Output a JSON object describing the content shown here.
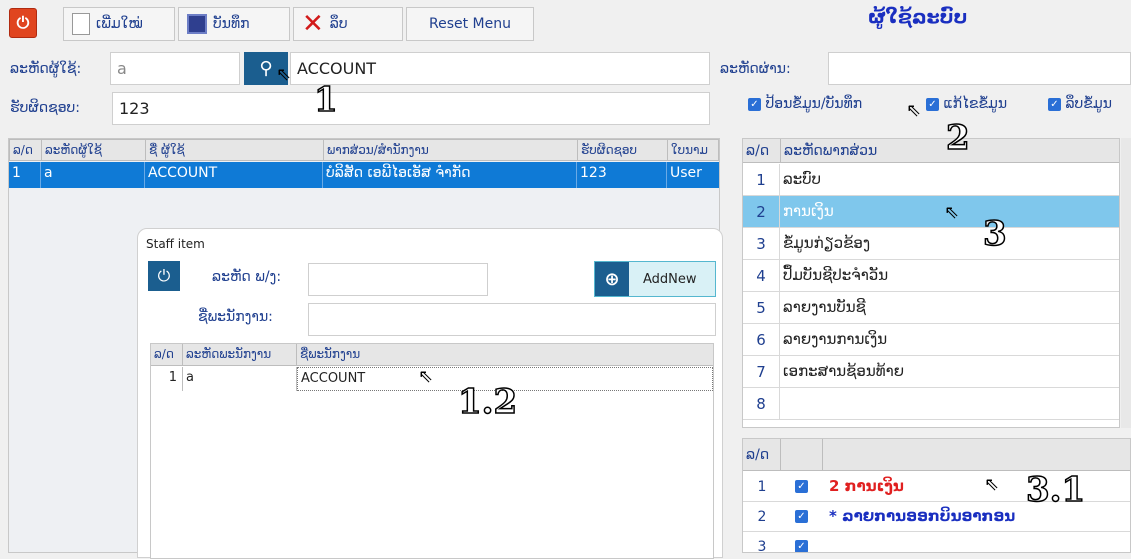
{
  "toolbar": {
    "new_label": "ເພີ່ມໃໝ່",
    "save_label": "ບັນທຶກ",
    "delete_label": "ລຶບ",
    "reset_label": "Reset Menu"
  },
  "header": {
    "title": "ຜູ້ໃຊ້ລະບົບ"
  },
  "form": {
    "user_code_label": "ລະຫັດຜູ້ໃຊ້:",
    "user_code_value": "a",
    "user_name_value": "ACCOUNT",
    "password_label": "ລະຫັດຜ່ານ:",
    "responsible_label": "ຮັບຜິດຊອບ:",
    "responsible_value": "123"
  },
  "permissions": {
    "input_save": "ປ້ອນຂໍ້ມູນ/ບັນທຶກ",
    "edit": "ແກ້ໄຂຂໍ້ມູນ",
    "delete": "ລຶບຂໍ້ມູນ"
  },
  "users_table": {
    "columns": [
      "ລ/ດ",
      "ລະຫັດຜູ້ໃຊ້",
      "ຊື່ ຜູ້ໃຊ້",
      "ພາກສ່ວນ/ສຳນັກງານ",
      "ຮັບຜິດຊອບ",
      "ໃບນາມ"
    ],
    "rows": [
      [
        "1",
        "a",
        "ACCOUNT",
        "ບໍລິສັດ ເອພີໄອເອັສ ຈຳກັດ",
        "123",
        "User"
      ]
    ]
  },
  "staff_panel": {
    "title": "Staff item",
    "staff_code_label": "ລະຫັດ ພ/ງ:",
    "staff_name_label": "ຊື່ພະນັກງານ:",
    "add_new_label": "AddNew",
    "columns": [
      "ລ/ດ",
      "ລະຫັດພະນັກງານ",
      "ຊື່ພະນັກງານ"
    ],
    "rows": [
      [
        "1",
        "a",
        "ACCOUNT"
      ]
    ]
  },
  "sections_table": {
    "columns": [
      "ລ/ດ",
      "ລະຫັດພາກສ່ວນ"
    ],
    "rows": [
      [
        "1",
        "ລະບົບ"
      ],
      [
        "2",
        "ການເງິນ"
      ],
      [
        "3",
        "ຂໍ້ມູນກ່ຽວຂ້ອງ"
      ],
      [
        "4",
        "ປຶ້ມບັນຊີປະຈຳວັນ"
      ],
      [
        "5",
        "ລາຍງານບັນຊີ"
      ],
      [
        "6",
        "ລາຍງານການເງິນ"
      ],
      [
        "7",
        "ເອກະສານຊ້ອນທ້າຍ"
      ],
      [
        "8",
        ""
      ]
    ],
    "selected_index": 1
  },
  "menu_table": {
    "header": "ລ/ດ",
    "rows": [
      {
        "num": "1",
        "text": "2 ການເງິນ",
        "color": "#e02020"
      },
      {
        "num": "2",
        "text": "* ລາຍການອອກບິນອາກອນ",
        "color": "#1a2fc0"
      },
      {
        "num": "3",
        "text": "",
        "color": "#1a2fc0"
      }
    ]
  },
  "annotations": [
    "1",
    "1.2",
    "2",
    "3",
    "3.1"
  ],
  "colors": {
    "accent": "#1b5e8f",
    "selected_row": "#0f7ad6",
    "selected_section": "#7fc7ec"
  }
}
